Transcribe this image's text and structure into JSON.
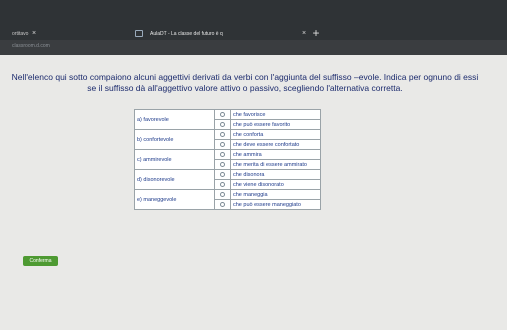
{
  "browser": {
    "tabs": [
      {
        "title": "ortitavo"
      },
      {
        "title": "AulaDT - La classe del futuro è q"
      }
    ],
    "close_glyph": "×",
    "new_tab_glyph": "+",
    "url": "classroom.d.com"
  },
  "exercise": {
    "instruction": "Nell'elenco qui sotto compaiono alcuni aggettivi derivati da verbi con l'aggiunta del suffisso –evole. Indica per ognuno di essi se il suffisso dà all'aggettivo valore attivo o passivo, scegliendo l'alternativa corretta.",
    "items": [
      {
        "label": "a) favorevole",
        "options": [
          "che favorisce",
          "che può essere favorito"
        ]
      },
      {
        "label": "b) confortevole",
        "options": [
          "che conforta",
          "che deve essere confortato"
        ]
      },
      {
        "label": "c) ammirevole",
        "options": [
          "che ammira",
          "che merita di essere ammirato"
        ]
      },
      {
        "label": "d) disonorevole",
        "options": [
          "che disonora",
          "che viene disonorato"
        ]
      },
      {
        "label": "e) maneggevole",
        "options": [
          "che maneggia",
          "che può essere maneggiato"
        ]
      }
    ],
    "confirm_label": "Conferma"
  },
  "colors": {
    "instruction_text": "#1c2b6d",
    "table_text": "#1d3a8a",
    "confirm_button": "#4e9a32",
    "tabbar": "#2f3336"
  }
}
